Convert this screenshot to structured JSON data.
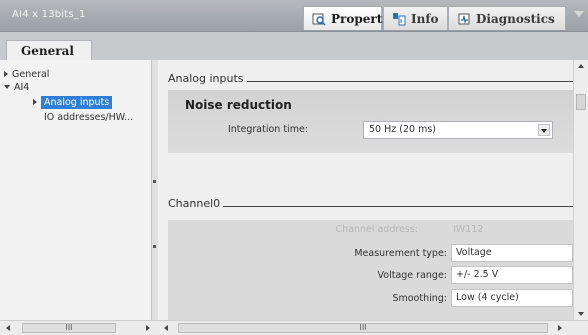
{
  "window": {
    "title": "AI4 x 13bits_1"
  },
  "top_tabs": [
    {
      "label": "Properties",
      "icon": "properties-icon",
      "active": true
    },
    {
      "label": "Info",
      "icon": "info-icon",
      "active": false
    },
    {
      "label": "Diagnostics",
      "icon": "diagnostics-icon",
      "active": false
    }
  ],
  "subtab": {
    "label": "General"
  },
  "tree": {
    "items": [
      {
        "label": "General",
        "expanded": false
      },
      {
        "label": "AI4",
        "expanded": true
      },
      {
        "label": "Analog inputs",
        "selected": true
      },
      {
        "label": "IO addresses/HW..."
      }
    ]
  },
  "content": {
    "analog_inputs_header": "Analog inputs",
    "noise_reduction": {
      "title": "Noise reduction",
      "integration_time_label": "Integration time:",
      "integration_time_value": "50 Hz (20 ms)"
    },
    "channel0_header": "Channel0",
    "channel": {
      "address_label": "Channel address:",
      "address_value": "IW112",
      "measurement_type_label": "Measurement type:",
      "measurement_type_value": "Voltage",
      "voltage_range_label": "Voltage range:",
      "voltage_range_value": "+/- 2.5 V",
      "smoothing_label": "Smoothing:",
      "smoothing_value": "Low (4 cycle)"
    }
  },
  "scrollbars": {
    "left_thumb_text": "III",
    "right_thumb_text": "III"
  },
  "colors": {
    "selection": "#2f7fd6",
    "titlebar": "#a7acb2"
  }
}
